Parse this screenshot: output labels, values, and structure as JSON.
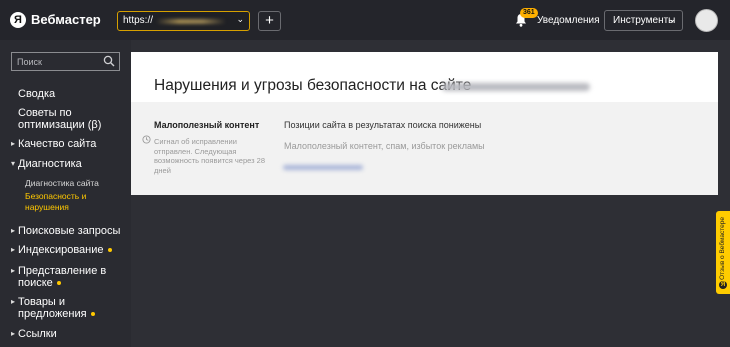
{
  "header": {
    "logo_letter": "Я",
    "app_name": "Вебмастер",
    "site_protocol": "https://",
    "site_chevron": "⌄",
    "add_label": "+",
    "notifications": {
      "count": "361",
      "label": "Уведомления"
    },
    "tools": {
      "label": "Инструменты",
      "chevron": "⌄"
    }
  },
  "sidebar": {
    "search": {
      "placeholder": "Поиск"
    },
    "items": [
      {
        "label": "Сводка"
      },
      {
        "label": "Советы по оптимизации (β)"
      },
      {
        "label": "Качество сайта"
      },
      {
        "label": "Диагностика"
      },
      {
        "label": "Диагностика сайта"
      },
      {
        "label": "Безопасность и нарушения"
      },
      {
        "label": "Поисковые запросы"
      },
      {
        "label": "Индексирование"
      },
      {
        "label": "Представление в поиске"
      },
      {
        "label": "Товары и предложения"
      },
      {
        "label": "Ссылки"
      }
    ]
  },
  "main": {
    "title": "Нарушения и угрозы безопасности на сайте",
    "issue": {
      "name": "Малополезный контент",
      "note": "Сигнал об исправлении отправлен. Следующая возможность появится через 28 дней",
      "effect": "Позиции сайта в результатах поиска понижены",
      "description": "Малополезный контент, спам, избыток рекламы"
    }
  },
  "feedback": {
    "label": "Отзыв о Вебмастере",
    "logo_letter": "Я"
  },
  "colors": {
    "accent": "#ffc800",
    "topbar": "#24252b",
    "sidebar": "#2a2b31",
    "page": "#2e2f35"
  },
  "icons": [
    "search-icon",
    "bell-icon",
    "chevron-down-icon",
    "clock-icon",
    "plus-icon"
  ]
}
